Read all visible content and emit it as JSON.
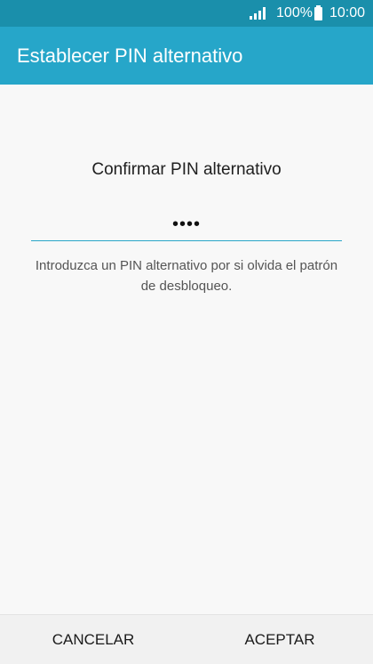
{
  "status_bar": {
    "battery_text": "100%",
    "time": "10:00",
    "icons": [
      "signal-icon",
      "battery-icon"
    ]
  },
  "app_bar": {
    "title": "Establecer PIN alternativo"
  },
  "main": {
    "heading": "Confirmar PIN alternativo",
    "pin_value": "••••",
    "helper_text": "Introduzca un PIN alternativo por si olvida el patrón de desbloqueo."
  },
  "bottom_bar": {
    "cancel_label": "CANCELAR",
    "accept_label": "ACEPTAR"
  },
  "colors": {
    "status_bar": "#1a8fab",
    "app_bar": "#26a6c9",
    "accent_underline": "#2aa6c8"
  }
}
